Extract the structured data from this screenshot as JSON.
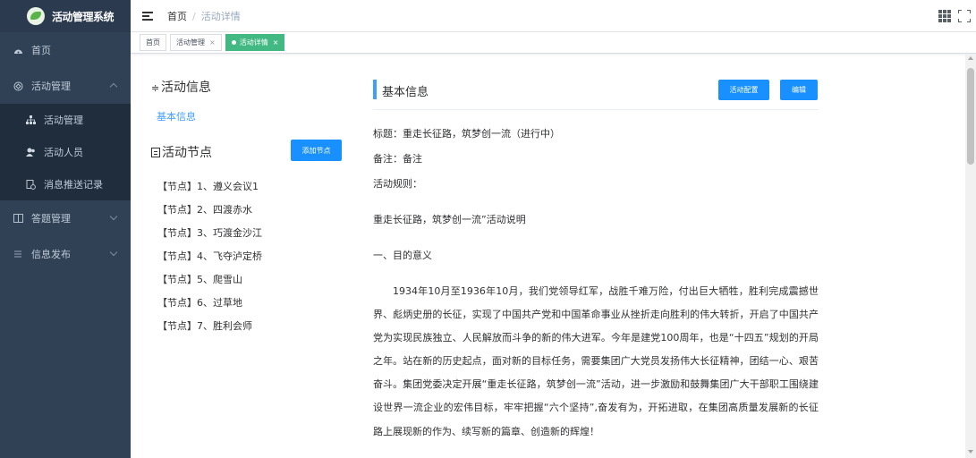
{
  "app": {
    "title": "活动管理系统"
  },
  "sidebar": {
    "items": [
      {
        "label": "首页",
        "icon": "dashboard-icon"
      },
      {
        "label": "活动管理",
        "icon": "activity-icon",
        "expanded": true,
        "children": [
          {
            "label": "活动管理",
            "icon": "tree-icon"
          },
          {
            "label": "活动人员",
            "icon": "people-icon"
          },
          {
            "label": "消息推送记录",
            "icon": "message-log-icon"
          }
        ]
      },
      {
        "label": "答题管理",
        "icon": "book-icon",
        "expanded": false
      },
      {
        "label": "信息发布",
        "icon": "list-icon",
        "expanded": false
      }
    ]
  },
  "navbar": {
    "breadcrumb": [
      "首页",
      "活动详情"
    ]
  },
  "tags": [
    {
      "label": "首页"
    },
    {
      "label": "活动管理",
      "close": "×"
    },
    {
      "label": "活动详情",
      "close": "×",
      "active": true
    }
  ],
  "left": {
    "info_title": "活动信息",
    "info_tab": "基本信息",
    "nodes_title": "活动节点",
    "add_node_label": "添加节点",
    "nodes": [
      "【节点】1、遵义会议1",
      "【节点】2、四渡赤水",
      "【节点】3、巧渡金沙江",
      "【节点】4、飞夺泸定桥",
      "【节点】5、爬雪山",
      "【节点】6、过草地",
      "【节点】7、胜利会师"
    ]
  },
  "basic": {
    "title": "基本信息",
    "config_label": "活动配置",
    "edit_label": "编辑",
    "lines": [
      "标题：重走长征路，筑梦创一流（进行中）",
      "备注：备注",
      "活动规则：",
      "重走长征路，筑梦创一流”活动说明",
      "一、目的意义"
    ],
    "paragraph": "1934年10月至1936年10月，我们党领导红军，战胜千难万险，付出巨大牺牲，胜利完成震撼世界、彪炳史册的长征，实现了中国共产党和中国革命事业从挫折走向胜利的伟大转折，开启了中国共产党为实现民族独立、人民解放而斗争的新的伟大进军。今年是建党100周年，也是“十四五”规划的开局之年。站在新的历史起点，面对新的目标任务，需要集团广大党员发扬伟大长征精神，团结一心、艰苦奋斗。集团党委决定开展“重走长征路，筑梦创一流”活动，进一步激励和鼓舞集团广大干部职工围绕建设世界一流企业的宏伟目标，牢牢把握“六个坚持”,奋发有为，开拓进取，在集团高质量发展新的长征路上展现新的作为、续写新的篇章、创造新的辉煌！"
  },
  "colors": {
    "sidebar_bg": "#304156",
    "accent": "#1890ff",
    "tag_active": "#42b983",
    "link": "#409eff"
  }
}
